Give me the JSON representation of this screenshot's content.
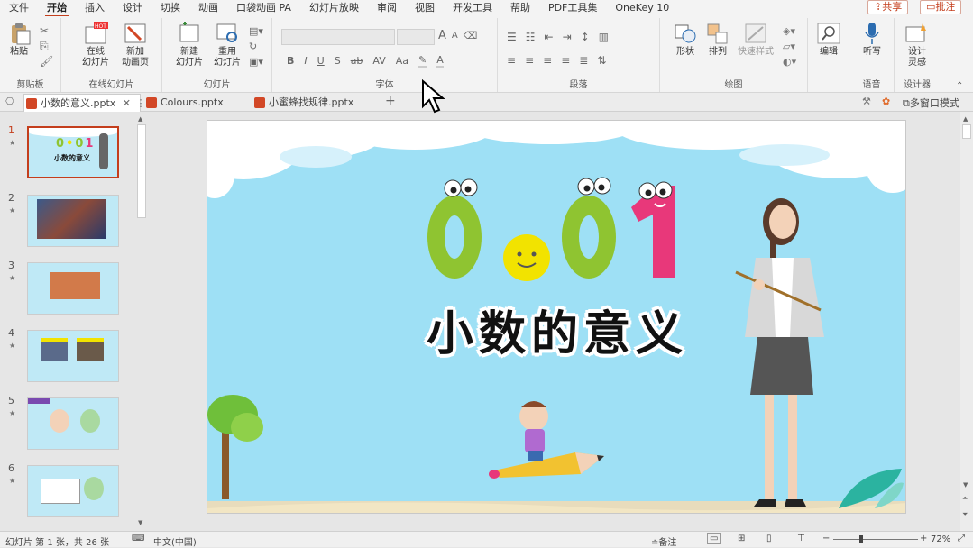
{
  "menu": {
    "tabs": [
      "文件",
      "开始",
      "插入",
      "设计",
      "切换",
      "动画",
      "口袋动画 PA",
      "幻灯片放映",
      "审阅",
      "视图",
      "开发工具",
      "帮助",
      "PDF工具集",
      "OneKey 10"
    ],
    "share_label": "共享",
    "comment_label": "批注"
  },
  "ribbon": {
    "clipboard": {
      "paste": "粘贴",
      "group": "剪贴板"
    },
    "online": {
      "online_slide": "在线\n幻灯片",
      "new_anim": "新加\n动画页",
      "group": "在线幻灯片",
      "hot_badge": "HOT"
    },
    "slides": {
      "new_slide": "新建\n幻灯片",
      "reuse": "重用\n幻灯片",
      "group": "幻灯片"
    },
    "font": {
      "group": "字体",
      "bold": "B",
      "italic": "I",
      "underline": "U",
      "shadow": "S",
      "strike": "ab",
      "spacing": "AV",
      "case": "Aa",
      "grow": "A",
      "shrink": "A",
      "color_a": "A"
    },
    "paragraph": {
      "group": "段落"
    },
    "drawing": {
      "shape": "形状",
      "arrange": "排列",
      "quick_style": "快速样式",
      "group": "绘图"
    },
    "editing": {
      "edit": "编辑"
    },
    "voice": {
      "dictate": "听写",
      "group": "语音"
    },
    "designer": {
      "design_ideas": "设计\n灵感",
      "group": "设计器"
    }
  },
  "file_tabs": [
    {
      "name": "小数的意义.pptx",
      "active": true
    },
    {
      "name": "Colours.pptx",
      "active": false
    },
    {
      "name": "小蜜蜂找规律.pptx",
      "active": false
    }
  ],
  "window_mode_label": "多窗口模式",
  "thumbnails": [
    {
      "num": "1",
      "star": "★"
    },
    {
      "num": "2",
      "star": "★"
    },
    {
      "num": "3",
      "star": "★"
    },
    {
      "num": "4",
      "star": "★"
    },
    {
      "num": "5",
      "star": "★"
    },
    {
      "num": "6",
      "star": "★"
    }
  ],
  "slide": {
    "number_chars": [
      "0",
      "0",
      "1"
    ],
    "title": "小数的意义",
    "thumb_title": "小数的意义"
  },
  "status": {
    "slide_info": "幻灯片 第 1 张，共 26 张",
    "language": "中文(中国)",
    "notes": "备注",
    "zoom": "72%"
  },
  "colors": {
    "accent": "#c43e1c",
    "number_green": "#8fc431",
    "number_pink": "#e8387a",
    "sky": "#9ee0f5"
  }
}
